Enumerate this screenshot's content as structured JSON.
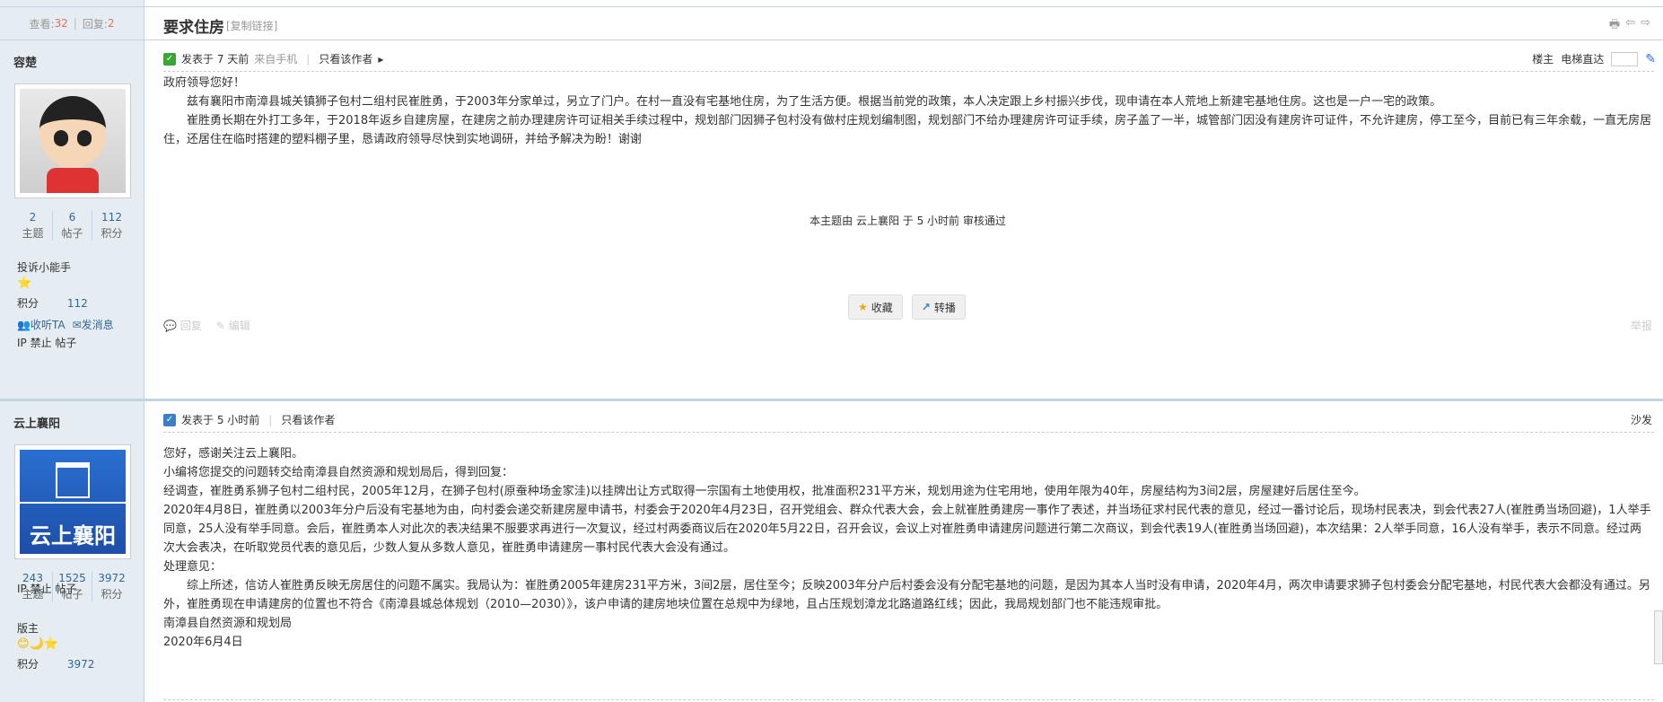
{
  "thread": {
    "views_label": "查看:",
    "views": "32",
    "replies_label": "回复:",
    "replies": "2",
    "title": "要求住房",
    "copy_link": "[复制链接]"
  },
  "posts": [
    {
      "author": "容楚",
      "stats": [
        {
          "value": "2",
          "label": "主题"
        },
        {
          "value": "6",
          "label": "帖子"
        },
        {
          "value": "112",
          "label": "积分"
        }
      ],
      "rank": "投诉小能手",
      "stars": "⭐",
      "score_label": "积分",
      "score": "112",
      "follow_label": "收听TA",
      "message_label": "发消息",
      "ipban": "IP 禁止 帖子",
      "meta_posted": "发表于 7 天前",
      "meta_from": "来自手机",
      "meta_only_author": "只看该作者",
      "meta_owner": "楼主",
      "meta_jump": "电梯直达",
      "paragraphs": [
        "政府领导您好！",
        "兹有襄阳市南漳县城关镇狮子包村二组村民崔胜勇，于2003年分家单过，另立了门户。在村一直没有宅基地住房，为了生活方便。根据当前党的政策，本人决定跟上乡村振兴步伐，现申请在本人荒地上新建宅基地住房。这也是一户一宅的政策。",
        "崔胜勇长期在外打工多年，于2018年返乡自建房屋，在建房之前办理建房许可证相关手续过程中，规划部门因狮子包村没有做村庄规划编制图，规划部门不给办理建房许可证手续，房子盖了一半，城管部门因没有建房许可证件，不允许建房，停工至今，目前已有三年余载，一直无房居住，还居住在临时搭建的塑料棚子里，恳请政府领导尽快到实地调研，并给予解决为盼！谢谢"
      ],
      "mod_note": "本主题由 云上襄阳 于 5 小时前 审核通过",
      "btn_fav": "收藏",
      "btn_share": "转播",
      "reply": "回复",
      "edit": "编辑",
      "report": "举报"
    },
    {
      "author": "云上襄阳",
      "avatar_text": "云上襄阳",
      "stats": [
        {
          "value": "243",
          "label": "主题"
        },
        {
          "value": "1525",
          "label": "帖子"
        },
        {
          "value": "3972",
          "label": "积分"
        }
      ],
      "rank": "版主",
      "stars": "😊🌙⭐",
      "score_label": "积分",
      "score": "3972",
      "ipban": "IP 禁止 帖子",
      "meta_posted": "发表于 5 小时前",
      "meta_only_author": "只看该作者",
      "floor": "沙发",
      "paragraphs": [
        "您好，感谢关注云上襄阳。",
        "小编将您提交的问题转交给南漳县自然资源和规划局后，得到回复：",
        "经调查，崔胜勇系狮子包村二组村民，2005年12月，在狮子包村(原蚕种场金家洼)以挂牌出让方式取得一宗国有土地使用权，批准面积231平方米，规划用途为住宅用地，使用年限为40年，房屋结构为3间2层，房屋建好后居住至今。",
        "2020年4月8日，崔胜勇以2003年分户后没有宅基地为由，向村委会递交新建房屋申请书，村委会于2020年4月23日，召开党组会、群众代表大会，会上就崔胜勇建房一事作了表述，并当场征求村民代表的意见，经过一番讨论后，现场村民表决，到会代表27人(崔胜勇当场回避)，1人举手同意，25人没有举手同意。会后，崔胜勇本人对此次的表决结果不服要求再进行一次复议，经过村两委商议后在2020年5月22日，召开会议，会议上对崔胜勇申请建房问题进行第二次商议，到会代表19人(崔胜勇当场回避)，本次结果：2人举手同意，16人没有举手，表示不同意。经过两次大会表决，在听取党员代表的意见后，少数人复从多数人意见，崔胜勇申请建房一事村民代表大会没有通过。",
        "处理意见：",
        "综上所述，信访人崔胜勇反映无房居住的问题不属实。我局认为：崔胜勇2005年建房231平方米，3间2层，居住至今；反映2003年分户后村委会没有分配宅基地的问题，是因为其本人当时没有申请，2020年4月，两次申请要求狮子包村委会分配宅基地，村民代表大会都没有通过。另外，崔胜勇现在申请建房的位置也不符合《南漳县城总体规划（2010—2030）》，该户申请的建房地块位置在总规中为绿地，且占压规划漳龙北路道路红线；因此，我局规划部门也不能违规审批。",
        "南漳县自然资源和规划局",
        "2020年6月4日"
      ]
    }
  ]
}
